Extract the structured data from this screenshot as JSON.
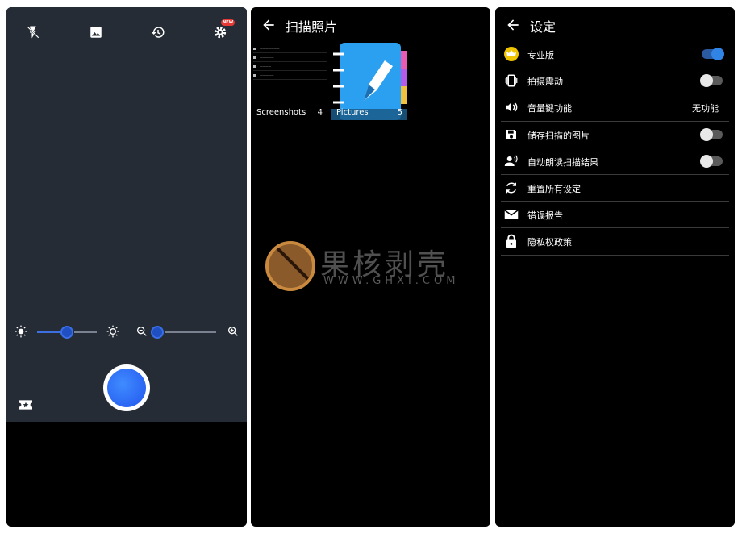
{
  "camera": {
    "icons": [
      "flash-off-icon",
      "image-icon",
      "history-icon",
      "settings-icon",
      "brightness-low-icon",
      "brightness-high-icon",
      "zoom-out-icon",
      "zoom-in-icon",
      "ticket-star-icon"
    ],
    "settings_badge": "NEW",
    "brightness_level": 0.6,
    "zoom_level": 0.1
  },
  "gallery": {
    "title": "扫描照片",
    "albums": [
      {
        "name": "Screenshots",
        "count": "4"
      },
      {
        "name": "Pictures",
        "count": "5"
      }
    ],
    "watermark": {
      "text": "果核剥壳",
      "url": "WWW.GHXI.COM"
    }
  },
  "settings": {
    "title": "设定",
    "items": [
      {
        "label": "专业版",
        "icon": "crown-icon",
        "toggle": true
      },
      {
        "label": "拍摄震动",
        "icon": "vibrate-icon",
        "toggle": false
      },
      {
        "label": "音量键功能",
        "icon": "volume-icon",
        "value": "无功能"
      },
      {
        "label": "储存扫描的图片",
        "icon": "save-icon",
        "toggle": false
      },
      {
        "label": "自动朗读扫描结果",
        "icon": "speak-icon",
        "toggle": false
      },
      {
        "label": "重置所有设定",
        "icon": "reset-icon"
      },
      {
        "label": "错误报告",
        "icon": "mail-icon"
      },
      {
        "label": "隐私权政策",
        "icon": "lock-icon"
      }
    ]
  },
  "colors": {
    "accent": "#2f84e6",
    "camera_bg": "#252c36",
    "shutter": "#2f6cf5"
  }
}
